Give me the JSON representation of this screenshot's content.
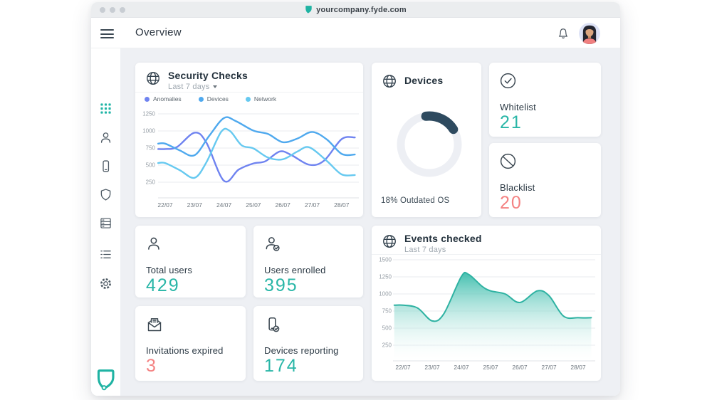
{
  "window": {
    "url": "yourcompany.fyde.com"
  },
  "topbar": {
    "title": "Overview"
  },
  "sidebar": {
    "items": [
      "apps-grid",
      "users",
      "devices",
      "security",
      "servers",
      "logs",
      "settings"
    ],
    "active": "apps-grid"
  },
  "colors": {
    "accent_teal": "#29b6a7",
    "accent_coral": "#f48282",
    "donut_arc": "#2e4a5f",
    "donut_track": "#edeff4",
    "area_fill": "#3abcab",
    "area_stroke": "#2eb2a2"
  },
  "cards": {
    "security_checks": {
      "title": "Security Checks",
      "range": "Last 7 days"
    },
    "devices": {
      "title": "Devices",
      "caption": "18% Outdated OS"
    },
    "whitelist": {
      "label": "Whitelist",
      "value": "21"
    },
    "blacklist": {
      "label": "Blacklist",
      "value": "20"
    },
    "total_users": {
      "label": "Total users",
      "value": "429"
    },
    "users_enrolled": {
      "label": "Users enrolled",
      "value": "395"
    },
    "invitations_expired": {
      "label": "Invitations expired",
      "value": "3"
    },
    "devices_reporting": {
      "label": "Devices reporting",
      "value": "174"
    },
    "events_checked": {
      "title": "Events checked",
      "range": "Last 7 days"
    }
  },
  "chart_data": [
    {
      "id": "security_checks",
      "type": "line",
      "title": "Security Checks",
      "subtitle": "Last 7 days",
      "grid": true,
      "legend_position": "top",
      "x_ticks": [
        22,
        23,
        24,
        25,
        26,
        27,
        28
      ],
      "x_tick_labels": [
        "22/07",
        "23/07",
        "24/07",
        "25/07",
        "26/07",
        "27/07",
        "28/07"
      ],
      "y_ticks": [
        250,
        500,
        750,
        1000,
        1250
      ],
      "ylim": [
        0,
        1350
      ],
      "series": [
        {
          "name": "Anomalies",
          "color": "#6f83f0",
          "x": [
            21.76,
            22,
            22.4,
            23,
            23.4,
            24,
            24.5,
            25,
            25.4,
            25.9,
            26.3,
            26.9,
            27.4,
            28,
            28.45
          ],
          "values": [
            735,
            735,
            765,
            975,
            830,
            270,
            435,
            525,
            555,
            700,
            645,
            505,
            565,
            880,
            905
          ]
        },
        {
          "name": "Devices",
          "color": "#4fa9ee",
          "x": [
            21.76,
            22,
            22.5,
            23,
            23.5,
            24,
            24.4,
            25,
            25.5,
            26,
            26.5,
            27,
            27.5,
            28,
            28.45
          ],
          "values": [
            815,
            815,
            715,
            645,
            930,
            1190,
            1145,
            1005,
            955,
            835,
            890,
            985,
            875,
            665,
            655
          ]
        },
        {
          "name": "Network",
          "color": "#66c9f0",
          "x": [
            21.76,
            22,
            22.5,
            23,
            23.4,
            23.9,
            24.2,
            24.6,
            25,
            25.5,
            26,
            26.5,
            26.9,
            27.5,
            28,
            28.45
          ],
          "values": [
            530,
            530,
            425,
            315,
            540,
            985,
            1000,
            790,
            745,
            610,
            585,
            700,
            760,
            560,
            365,
            355
          ]
        }
      ]
    },
    {
      "id": "devices_donut",
      "type": "donut",
      "title": "Devices",
      "percent": 18,
      "label": "18% Outdated OS",
      "arc_color": "#2e4a5f",
      "track_color": "#edeff4"
    },
    {
      "id": "events_checked",
      "type": "area",
      "title": "Events checked",
      "subtitle": "Last 7 days",
      "grid": true,
      "x_ticks": [
        22,
        23,
        24,
        25,
        26,
        27,
        28
      ],
      "x_tick_labels": [
        "22/07",
        "23/07",
        "24/07",
        "25/07",
        "26/07",
        "27/07",
        "28/07"
      ],
      "y_ticks": [
        250,
        500,
        750,
        1000,
        1250,
        1500
      ],
      "ylim": [
        0,
        1550
      ],
      "color": "#3abcab",
      "x": [
        21.7,
        22,
        22.5,
        23,
        23.4,
        24,
        24.25,
        24.7,
        25,
        25.5,
        26,
        26.6,
        27,
        27.5,
        28,
        28.45
      ],
      "values": [
        835,
        835,
        795,
        605,
        710,
        1255,
        1285,
        1115,
        1045,
        1000,
        875,
        1045,
        975,
        675,
        652,
        652
      ]
    }
  ]
}
